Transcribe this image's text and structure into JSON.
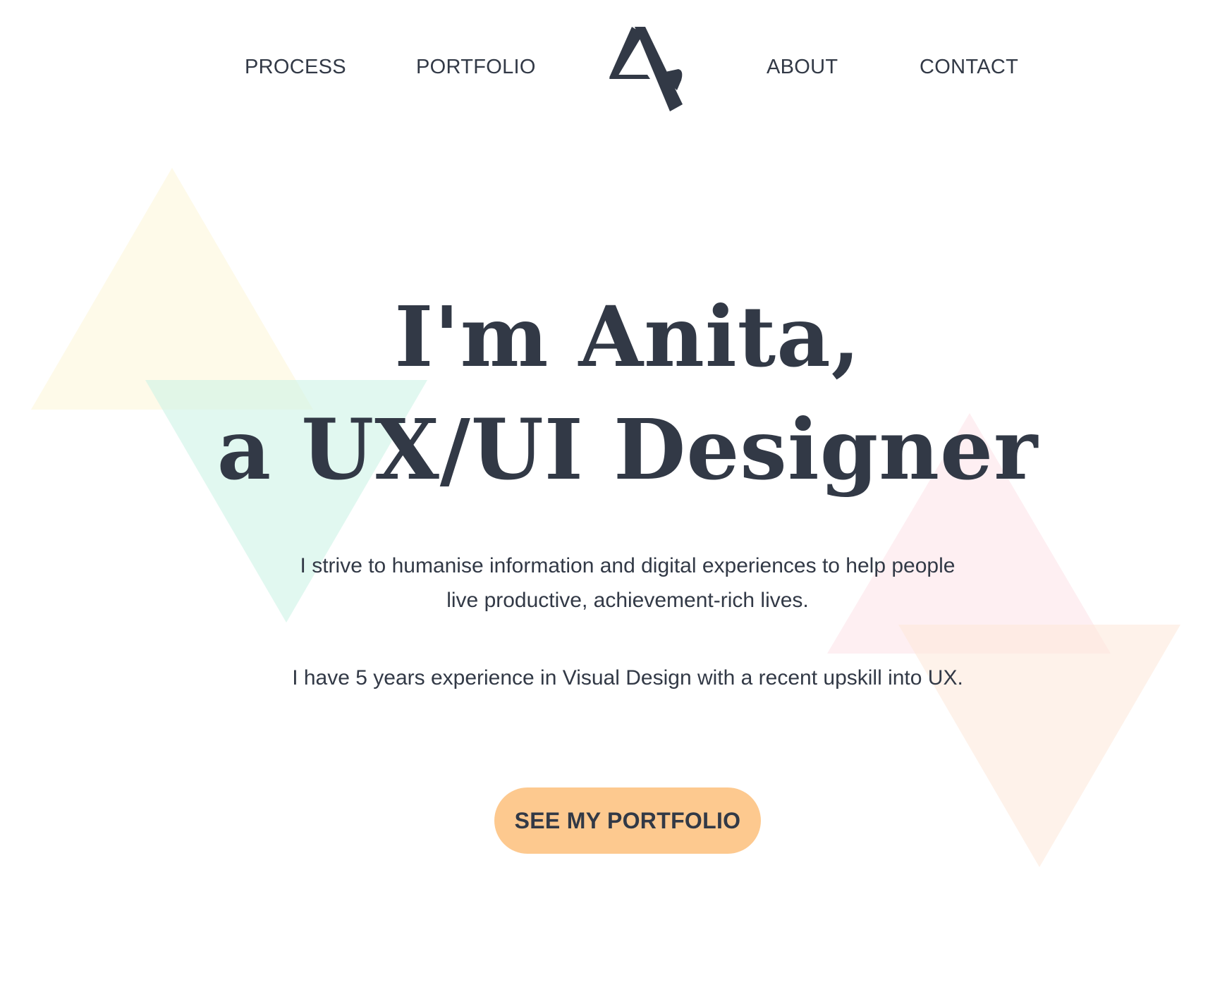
{
  "nav": {
    "items": [
      {
        "label": "PROCESS"
      },
      {
        "label": "PORTFOLIO"
      },
      {
        "label": "ABOUT"
      },
      {
        "label": "CONTACT"
      }
    ],
    "logo_icon": "av-monogram-logo-icon"
  },
  "hero": {
    "title_line_1": "I'm Anita,",
    "title_line_2": "a UX/UI Designer",
    "description_line_1": "I strive to humanise information and digital experiences to help people",
    "description_line_2": "live productive, achievement-rich lives.",
    "experience": "I have 5 years experience in Visual Design with a recent upskill into UX.",
    "cta_label": "SEE MY PORTFOLIO"
  },
  "colors": {
    "text": "#323946",
    "cta_background": "#fdc98f",
    "triangle_yellow": "#fef8e2",
    "triangle_mint": "#cdf4e6",
    "triangle_pink": "#fde4ea",
    "triangle_peach": "#fee8d9"
  }
}
